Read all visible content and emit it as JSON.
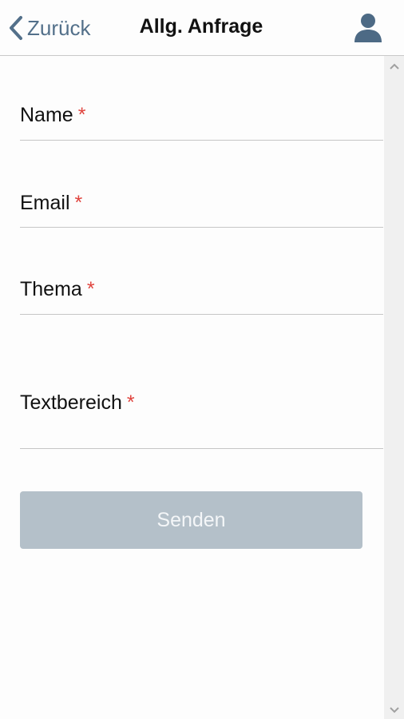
{
  "header": {
    "back_label": "Zurück",
    "title": "Allg. Anfrage",
    "back_icon": "chevron-left-icon",
    "user_icon": "user-icon"
  },
  "form": {
    "fields": [
      {
        "label": "Name",
        "required": "*",
        "value": ""
      },
      {
        "label": "Email",
        "required": "*",
        "value": ""
      },
      {
        "label": "Thema",
        "required": "*",
        "value": ""
      },
      {
        "label": "Textbereich",
        "required": "*",
        "value": ""
      }
    ],
    "submit_label": "Senden",
    "submit_enabled": false
  },
  "colors": {
    "accent": "#53708a",
    "required": "#e0443e",
    "button_disabled": "#b4c0c9",
    "divider": "#c6c6c6"
  }
}
